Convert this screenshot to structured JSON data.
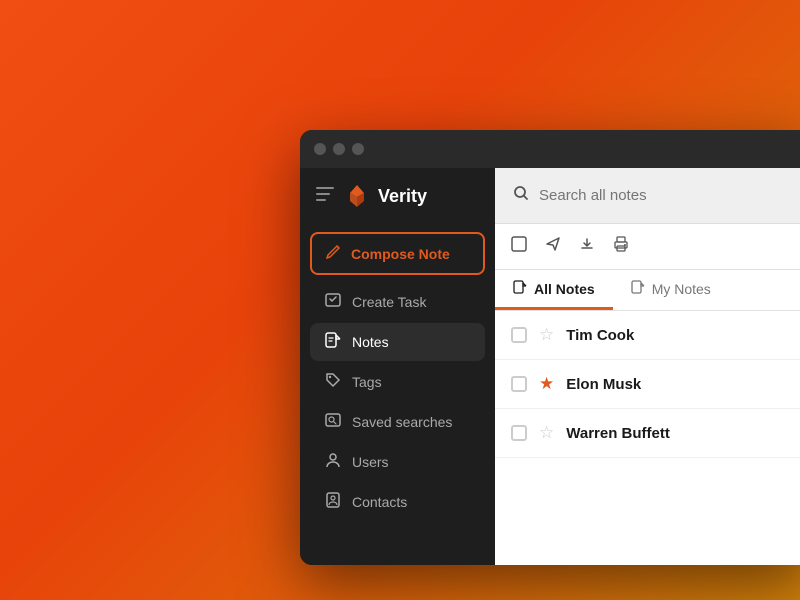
{
  "window": {
    "title": "Verity",
    "traffic_lights": [
      "close",
      "minimize",
      "maximize"
    ]
  },
  "sidebar": {
    "logo_text": "Verity",
    "compose_label": "Compose Note",
    "nav_items": [
      {
        "id": "create-task",
        "label": "Create Task",
        "icon": "📋"
      },
      {
        "id": "notes",
        "label": "Notes",
        "icon": "📓",
        "active": true
      },
      {
        "id": "tags",
        "label": "Tags",
        "icon": "🏷️"
      },
      {
        "id": "saved-searches",
        "label": "Saved searches",
        "icon": "🔍"
      },
      {
        "id": "users",
        "label": "Users",
        "icon": "👤"
      },
      {
        "id": "contacts",
        "label": "Contacts",
        "icon": "📇"
      }
    ]
  },
  "content": {
    "search_placeholder": "Search all notes",
    "tabs": [
      {
        "id": "all-notes",
        "label": "All Notes",
        "active": true
      },
      {
        "id": "my-notes",
        "label": "My Notes",
        "active": false
      }
    ],
    "notes": [
      {
        "id": "tim-cook",
        "name": "Tim Cook",
        "starred": false
      },
      {
        "id": "elon-musk",
        "name": "Elon Musk",
        "starred": true
      },
      {
        "id": "warren-buffett",
        "name": "Warren Buffett",
        "starred": false
      }
    ]
  },
  "icons": {
    "menu": "≡",
    "compose": "✏",
    "search": "🔍",
    "checkbox": "☐",
    "send": "➤",
    "download": "⬇",
    "print": "🖨",
    "note_tab": "📓",
    "star_empty": "☆",
    "star_filled": "★"
  }
}
